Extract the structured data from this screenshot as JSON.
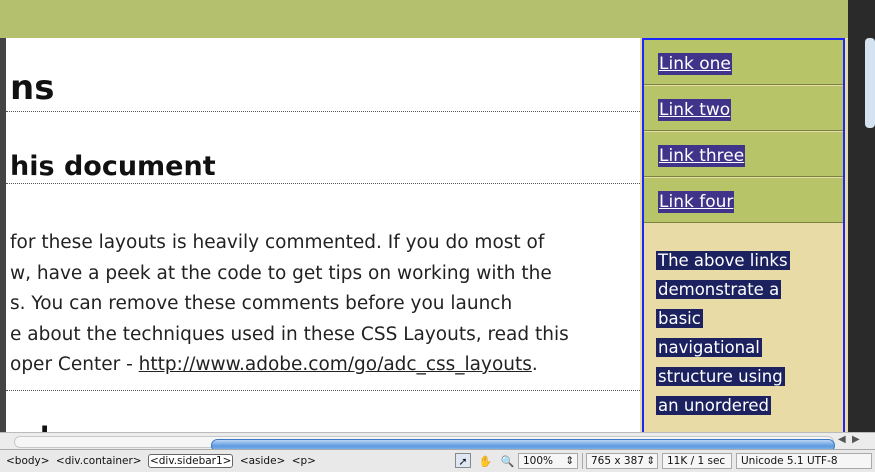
{
  "document": {
    "heading1": "ns",
    "heading2": "his document",
    "paragraph_lines": [
      "for these layouts is heavily commented. If you do most of",
      "w, have a peek at the code to get tips on working with the",
      "s. You can remove these comments before you launch",
      "e about the techniques used in these CSS Layouts, read this"
    ],
    "last_line_prefix": "oper Center - ",
    "link": "http://www.adobe.com/go/adc_css_layouts",
    "last_line_suffix": ".",
    "heading3_fragment": "l"
  },
  "sidebar": {
    "nav_links": [
      "Link one",
      "Link two",
      "Link three",
      "Link four"
    ],
    "text_lines": [
      "The above links",
      "demonstrate a",
      "basic",
      "navigational",
      "structure using",
      "an unordered"
    ]
  },
  "statusbar": {
    "tags": [
      "<body>",
      "<div.container>",
      "<div.sidebar1>",
      "<aside>",
      "<p>"
    ],
    "active_tag_index": 2,
    "tools": [
      {
        "icon": "arrow-select-icon",
        "glyph": "➚"
      },
      {
        "icon": "hand-icon",
        "glyph": "✋"
      },
      {
        "icon": "zoom-icon",
        "glyph": "🔍"
      }
    ],
    "zoom": "100%",
    "window_size": "765 x 387",
    "download": "11K / 1 sec",
    "encoding": "Unicode 5.1 UTF-8"
  },
  "scroll": {
    "horizontal_thumb_start": 0.24,
    "horizontal_thumb_fraction": 0.76
  },
  "colors": {
    "band": "#b4c06e",
    "sidebar_bg": "#e8dba5",
    "nav_bg": "#b7c468",
    "selection_border": "#1a28ff",
    "text_highlight": "#1c2260"
  }
}
